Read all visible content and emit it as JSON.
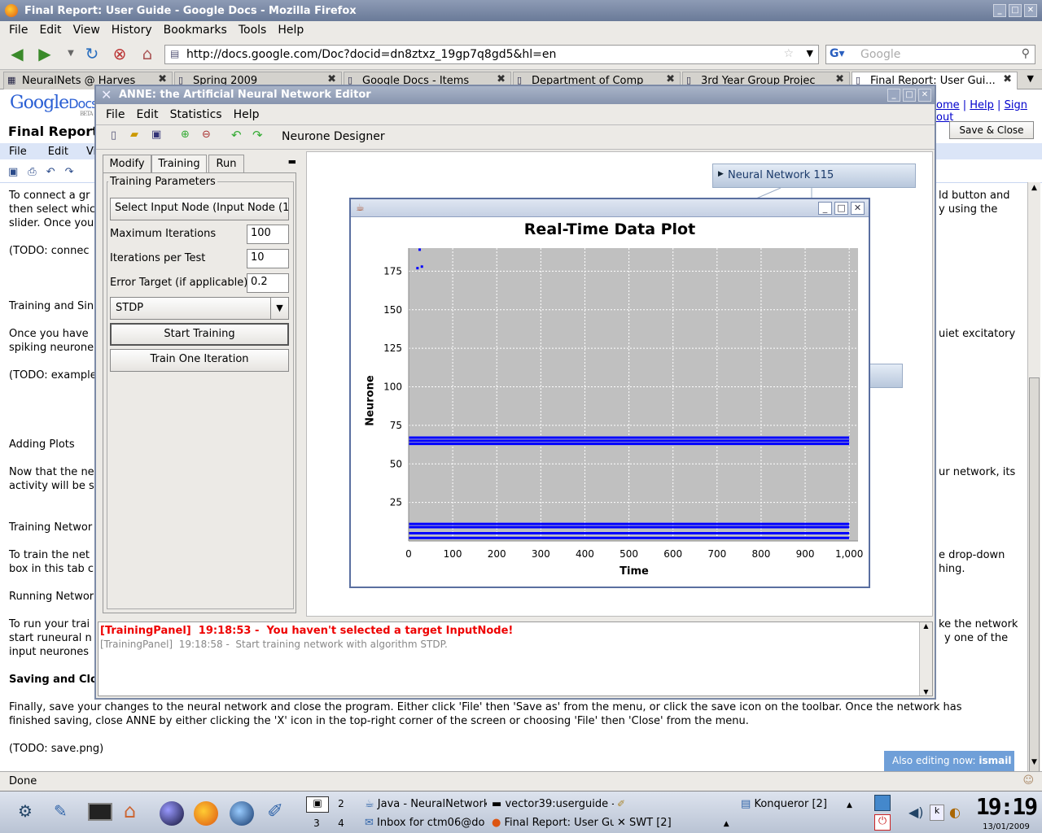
{
  "firefox": {
    "title": "Final Report: User Guide - Google Docs - Mozilla Firefox",
    "menu": [
      "File",
      "Edit",
      "View",
      "History",
      "Bookmarks",
      "Tools",
      "Help"
    ],
    "url": "http://docs.google.com/Doc?docid=dn8ztxz_19gp7q8gd5&hl=en",
    "search_placeholder": "Google",
    "tabs": [
      {
        "label": "NeuralNets @ Harves",
        "active": false
      },
      {
        "label": "Spring 2009",
        "active": false
      },
      {
        "label": "Google Docs - Items",
        "active": false
      },
      {
        "label": "Department of Comp",
        "active": false
      },
      {
        "label": "3rd Year Group Projec",
        "active": false
      },
      {
        "label": "Final Report: User Gui...",
        "active": true
      }
    ],
    "status": "Done"
  },
  "gdocs": {
    "logo_google": "Google",
    "logo_docs": "Docs",
    "logo_beta": "BETA",
    "doc_title": "Final Report:",
    "top_links": [
      "ome",
      "Help",
      "Sign out"
    ],
    "save_close": "Save & Close",
    "menu": [
      "File",
      "Edit",
      "View"
    ],
    "also_editing_label": "Also editing now:",
    "also_editing_user": "ismail g",
    "left_lines": [
      {
        "text": "To connect a gr",
        "y": 233
      },
      {
        "text": "then select whic",
        "y": 250
      },
      {
        "text": "slider. Once you",
        "y": 267
      },
      {
        "text": "(TODO: connec",
        "y": 301
      },
      {
        "text": "Training and Sin",
        "y": 369
      },
      {
        "text": "Once you have",
        "y": 403
      },
      {
        "text": "spiking neurone",
        "y": 420
      },
      {
        "text": "(TODO: example",
        "y": 454
      },
      {
        "text": "Adding Plots",
        "y": 539
      },
      {
        "text": "Now that the ne",
        "y": 573
      },
      {
        "text": "activity will be s",
        "y": 590
      },
      {
        "text": "Training Networ",
        "y": 641
      },
      {
        "text": "To train the net",
        "y": 675
      },
      {
        "text": "box in this tab c",
        "y": 692
      },
      {
        "text": "Running Networ",
        "y": 726
      },
      {
        "text": "To run your trai",
        "y": 760
      },
      {
        "text": "start runeural n",
        "y": 777
      },
      {
        "text": "input neurones",
        "y": 794
      },
      {
        "text": "Saving and Clo",
        "y": 828,
        "bold": true
      }
    ],
    "right_lines": [
      {
        "text": "ld button and",
        "x": 1153,
        "y": 233
      },
      {
        "text": "y using the",
        "x": 1153,
        "y": 250
      },
      {
        "text": "uiet excitatory",
        "x": 1153,
        "y": 403
      },
      {
        "text": "ur network, its",
        "x": 1153,
        "y": 573
      },
      {
        "text": "e drop-down",
        "x": 1153,
        "y": 675
      },
      {
        "text": "hing.",
        "x": 1153,
        "y": 692
      },
      {
        "text": "ke the network",
        "x": 1153,
        "y": 760
      },
      {
        "text": "y one of the",
        "x": 1160,
        "y": 777
      }
    ],
    "bottom_lines": [
      {
        "text": "Finally, save your changes to the neural network and close the program. Either click 'File' then 'Save as' from the menu, or click the save icon on the toolbar. Once the network has",
        "y": 862
      },
      {
        "text": "finished saving, close ANNE by either clicking the 'X' icon in the top-right corner of the screen or choosing 'File' then 'Close' from the menu.",
        "y": 879
      },
      {
        "text": "(TODO: save.png)",
        "y": 913
      }
    ]
  },
  "anne": {
    "title": "ANNE: the Artificial Neural Network Editor",
    "menu": [
      "File",
      "Edit",
      "Statistics",
      "Help"
    ],
    "toolbar_label": "Neurone Designer",
    "tabs": [
      "Modify",
      "Training",
      "Run"
    ],
    "active_tab": "Training",
    "group_label": "Training Parameters",
    "select_input_button": "Select Input Node (Input Node (1",
    "max_iter_label": "Maximum Iterations",
    "max_iter_value": "100",
    "iter_per_test_label": "Iterations per Test",
    "iter_per_test_value": "10",
    "error_target_label": "Error Target (if applicable)",
    "error_target_value": "0.2",
    "algorithm": "STDP",
    "start_button": "Start Training",
    "train_one_button": "Train One Iteration",
    "network_node": "Neural Network 115",
    "log": [
      {
        "source": "[TrainingPanel]",
        "time": "19:18:53 -",
        "message": "You haven't selected a target InputNode!",
        "error": true
      },
      {
        "source": "[TrainingPanel]",
        "time": "19:18:58 -",
        "message": "Start training network with algorithm STDP.",
        "error": false
      }
    ]
  },
  "chart_data": {
    "type": "scatter",
    "title": "Real-Time Data Plot",
    "xlabel": "Time",
    "ylabel": "Neurone",
    "xlim": [
      0,
      1020
    ],
    "ylim": [
      0,
      190
    ],
    "x_ticks": [
      "0",
      "100",
      "200",
      "300",
      "400",
      "500",
      "600",
      "700",
      "800",
      "900",
      "1,000"
    ],
    "y_ticks": [
      "25",
      "50",
      "75",
      "100",
      "125",
      "150",
      "175"
    ],
    "grid": true,
    "marker_color": "#0000ff",
    "series": [
      {
        "values": [
          {
            "x": [
              0,
              1000
            ],
            "y": 67
          },
          {
            "x": [
              0,
              1000
            ],
            "y": 65
          },
          {
            "x": [
              0,
              1000
            ],
            "y": 63
          },
          {
            "x": [
              0,
              1000
            ],
            "y": 11
          },
          {
            "x": [
              0,
              1000
            ],
            "y": 9
          },
          {
            "x": [
              0,
              1000
            ],
            "y": 5
          },
          {
            "x": [
              0,
              1000
            ],
            "y": 2
          }
        ]
      }
    ],
    "points": [
      {
        "x": 25,
        "y": 189
      },
      {
        "x": 20,
        "y": 177
      },
      {
        "x": 30,
        "y": 178
      }
    ]
  },
  "taskbar": {
    "desktops": [
      "2",
      "3",
      "4"
    ],
    "tasks": [
      {
        "label": "Java - NeuralNetwork"
      },
      {
        "label": "vector39:userguide -"
      },
      {
        "label": "Inbox for ctm06@do"
      },
      {
        "label": "Final Report: User Gu"
      },
      {
        "label": "SWT [2]"
      },
      {
        "label": "Konqueror [2]"
      }
    ],
    "clock_time": "19:19",
    "clock_date": "13/01/2009"
  }
}
